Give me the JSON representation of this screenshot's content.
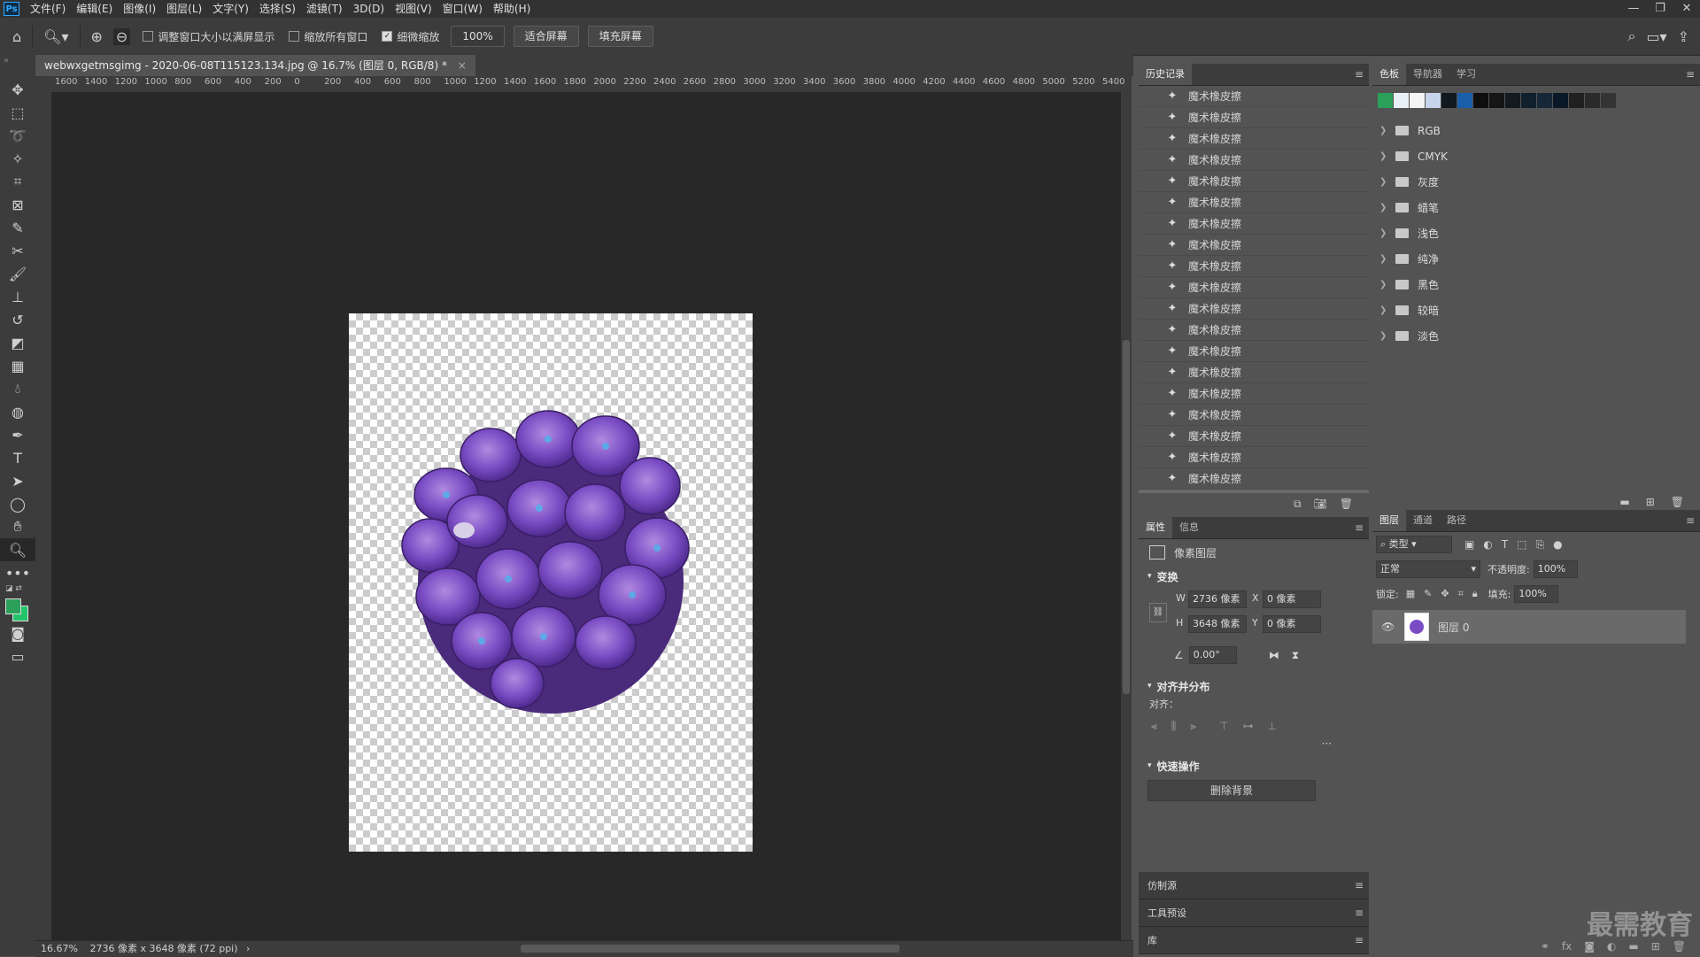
{
  "app": {
    "logo": "Ps"
  },
  "menu": [
    "文件(F)",
    "编辑(E)",
    "图像(I)",
    "图层(L)",
    "文字(Y)",
    "选择(S)",
    "滤镜(T)",
    "3D(D)",
    "视图(V)",
    "窗口(W)",
    "帮助(H)"
  ],
  "window_controls": [
    "—",
    "❐",
    "✕"
  ],
  "options": {
    "resize_windows_label": "调整窗口大小以满屏显示",
    "zoom_all_label": "缩放所有窗口",
    "scrubby_zoom_label": "细微缩放",
    "scrubby_checked_mark": "✓",
    "zoom_value": "100%",
    "fit_screen": "适合屏幕",
    "fill_screen": "填充屏幕"
  },
  "document": {
    "tab_title": "webwxgetmsgimg - 2020-06-08T115123.134.jpg @ 16.7% (图层 0, RGB/8) *",
    "close": "×",
    "ruler_labels": [
      "1600",
      "1400",
      "1200",
      "1000",
      "800",
      "600",
      "400",
      "200",
      "0",
      "200",
      "400",
      "600",
      "800",
      "1000",
      "1200",
      "1400",
      "1600",
      "1800",
      "2000",
      "2200",
      "2400",
      "2600",
      "2800",
      "3000",
      "3200",
      "3400",
      "3600",
      "3800",
      "4000",
      "4200",
      "4400",
      "4600",
      "4800",
      "5000",
      "5200",
      "5400"
    ]
  },
  "status": {
    "zoom": "16.67%",
    "info": "2736 像素 x 3648 像素 (72 ppi)"
  },
  "history": {
    "tab": "历史记录",
    "items": [
      "魔术橡皮擦",
      "魔术橡皮擦",
      "魔术橡皮擦",
      "魔术橡皮擦",
      "魔术橡皮擦",
      "魔术橡皮擦",
      "魔术橡皮擦",
      "魔术橡皮擦",
      "魔术橡皮擦",
      "魔术橡皮擦",
      "魔术橡皮擦",
      "魔术橡皮擦",
      "魔术橡皮擦",
      "魔术橡皮擦",
      "魔术橡皮擦",
      "魔术橡皮擦",
      "魔术橡皮擦",
      "魔术橡皮擦",
      "魔术橡皮擦",
      "魔术橡皮擦"
    ]
  },
  "swatches": {
    "tabs": [
      "色板",
      "导航器",
      "学习"
    ],
    "colors": [
      "#2aa05a",
      "#e8f0f8",
      "#f4f4f4",
      "#c8d4ec",
      "#101820",
      "#1a5ea8",
      "#0e0e0e",
      "#151515",
      "#141a20",
      "#10202c",
      "#162838",
      "#0a1828",
      "#202020",
      "#2a2a2a",
      "#343434"
    ],
    "groups": [
      "RGB",
      "CMYK",
      "灰度",
      "蜡笔",
      "浅色",
      "纯净",
      "黑色",
      "较暗",
      "淡色"
    ]
  },
  "properties": {
    "tabs": [
      "属性",
      "信息"
    ],
    "type_label": "像素图层",
    "transform_label": "变换",
    "w_label": "W",
    "w_value": "2736 像素",
    "x_label": "X",
    "x_value": "0 像素",
    "h_label": "H",
    "h_value": "3648 像素",
    "y_label": "Y",
    "y_value": "0 像素",
    "angle_value": "0.00°",
    "align_section": "对齐并分布",
    "align_label": "对齐：",
    "more": "···",
    "quick_actions": "快速操作",
    "remove_bg": "删除背景"
  },
  "docked_panels": [
    "仿制源",
    "工具预设",
    "库"
  ],
  "layers": {
    "tabs": [
      "图层",
      "通道",
      "路径"
    ],
    "filter_kind": "类型",
    "blend_mode": "正常",
    "opacity_label": "不透明度:",
    "opacity_value": "100%",
    "lock_label": "锁定:",
    "fill_label": "填充:",
    "fill_value": "100%",
    "layer_name": "图层 0"
  },
  "watermark": "最需教育"
}
